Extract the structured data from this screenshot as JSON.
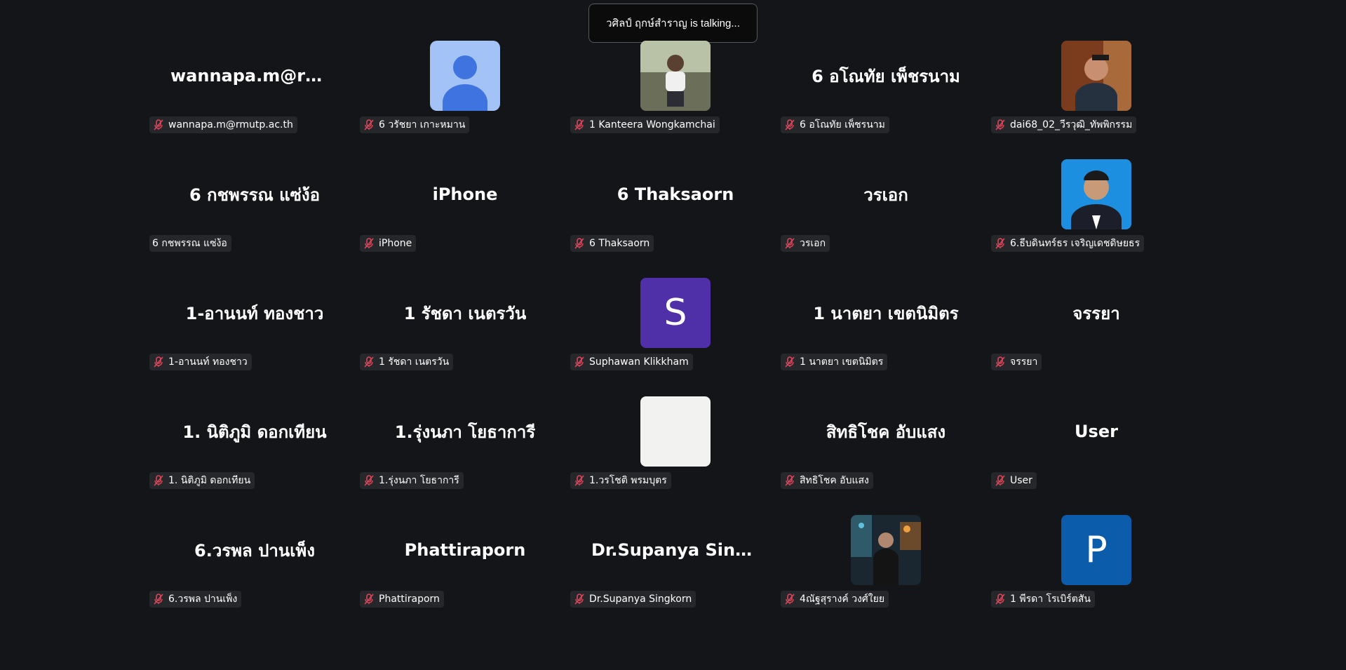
{
  "toast": {
    "text": "วศิลป์ ฤกษ์สำราญ is talking..."
  },
  "colors": {
    "background": "#141518",
    "label_bg": "#26272b",
    "muted_icon": "#e0455a",
    "toast_border": "#55585e"
  },
  "participants": [
    {
      "name": "wannapa.m@rm...",
      "label": "wannapa.m@rmutp.ac.th",
      "muted": true,
      "display": "text"
    },
    {
      "name": "",
      "label": "6 วรัชยา เกาะหมาน",
      "muted": true,
      "display": "generic-avatar-icon"
    },
    {
      "name": "",
      "label": "1 Kanteera Wongkamchai",
      "muted": true,
      "display": "photo"
    },
    {
      "name": "6 อโณทัย เพ็ชรนาม",
      "label": "6 อโณทัย เพ็ชรนาม",
      "muted": true,
      "display": "text"
    },
    {
      "name": "",
      "label": "dai68_02_วีรวุฒิ_ทัพพิกรรม",
      "muted": true,
      "display": "photo"
    },
    {
      "name": "6 กชพรรณ แซ่ง้อ",
      "label": "6 กชพรรณ แซ่ง้อ",
      "muted": false,
      "display": "text"
    },
    {
      "name": "iPhone",
      "label": "iPhone",
      "muted": true,
      "display": "text"
    },
    {
      "name": "6 Thaksaorn",
      "label": "6 Thaksaorn",
      "muted": true,
      "display": "text"
    },
    {
      "name": "วรเอก",
      "label": "วรเอก",
      "muted": true,
      "display": "text"
    },
    {
      "name": "",
      "label": "6.ธีบดินทร์ธร เจริญเดชดิษยธร",
      "muted": true,
      "display": "photo"
    },
    {
      "name": "1-อานนท์ ทองชาว",
      "label": "1-อานนท์ ทองชาว",
      "muted": true,
      "display": "text"
    },
    {
      "name": "1 รัชดา เนตรวัน",
      "label": "1 รัชดา เนตรวัน",
      "muted": true,
      "display": "text"
    },
    {
      "name": "",
      "label": "Suphawan Klikkham",
      "muted": true,
      "display": "letter",
      "letter": "S"
    },
    {
      "name": "1 นาตยา เขตนิมิตร",
      "label": "1 นาตยา เขตนิมิตร",
      "muted": true,
      "display": "text"
    },
    {
      "name": "จรรยา",
      "label": "จรรยา",
      "muted": true,
      "display": "text"
    },
    {
      "name": "1. นิติภูมิ ดอกเทียน",
      "label": "1. นิติภูมิ ดอกเทียน",
      "muted": true,
      "display": "text"
    },
    {
      "name": "1.รุ่งนภา  โยธาการี",
      "label": "1.รุ่งนภา  โยธาการี",
      "muted": true,
      "display": "text"
    },
    {
      "name": "",
      "label": "1.วรโชติ พรมบุตร",
      "muted": true,
      "display": "blank"
    },
    {
      "name": "สิทธิโชค อับแสง",
      "label": "สิทธิโชค อับแสง",
      "muted": true,
      "display": "text"
    },
    {
      "name": "User",
      "label": "User",
      "muted": true,
      "display": "text"
    },
    {
      "name": "6.วรพล ปานเพ็ง",
      "label": "6.วรพล ปานเพ็ง",
      "muted": true,
      "display": "text"
    },
    {
      "name": "Phattiraporn",
      "label": "Phattiraporn",
      "muted": true,
      "display": "text"
    },
    {
      "name": "Dr.Supanya  Sing...",
      "label": "Dr.Supanya Singkorn",
      "muted": true,
      "display": "text"
    },
    {
      "name": "",
      "label": "4ณัฐสุรางค์ วงศ์ใยย",
      "muted": true,
      "display": "photo"
    },
    {
      "name": "",
      "label": "1 พีรดา โรเบิร์ตสัน",
      "muted": true,
      "display": "letter",
      "letter": "P"
    }
  ]
}
